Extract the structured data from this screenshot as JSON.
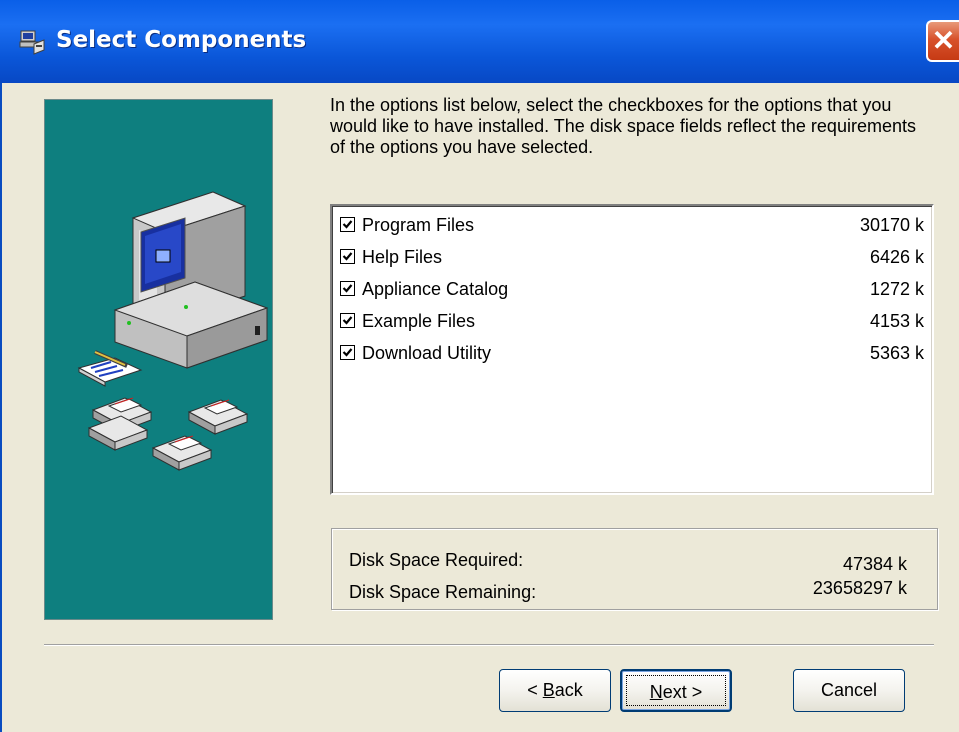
{
  "window": {
    "title": "Select Components",
    "close_glyph": "✕"
  },
  "instructions": "In the options list below, select the checkboxes for the options that you would like to have installed.  The disk space fields reflect the requirements of the options you have selected.",
  "components": [
    {
      "label": "Program Files",
      "size": "30170 k",
      "checked": true
    },
    {
      "label": "Help Files",
      "size": "6426 k",
      "checked": true
    },
    {
      "label": "Appliance Catalog",
      "size": "1272 k",
      "checked": true
    },
    {
      "label": "Example Files",
      "size": "4153 k",
      "checked": true
    },
    {
      "label": "Download Utility",
      "size": "5363 k",
      "checked": true
    }
  ],
  "disk_space": {
    "required_label": "Disk Space Required:",
    "required_value": "47384 k",
    "remaining_label": "Disk Space Remaining:",
    "remaining_value": "23658297 k"
  },
  "buttons": {
    "back_prefix": "< ",
    "back_mnemonic": "B",
    "back_rest": "ack",
    "next_mnemonic": "N",
    "next_rest": "ext >",
    "cancel": "Cancel"
  },
  "colors": {
    "titlebar": "#0A5FE8",
    "panel": "#0E7F7F",
    "dialog_bg": "#ECE9D8",
    "close": "#D8522C"
  },
  "icons": [
    "installer-icon",
    "close-icon",
    "checkbox-check-icon",
    "computer-illustration"
  ]
}
